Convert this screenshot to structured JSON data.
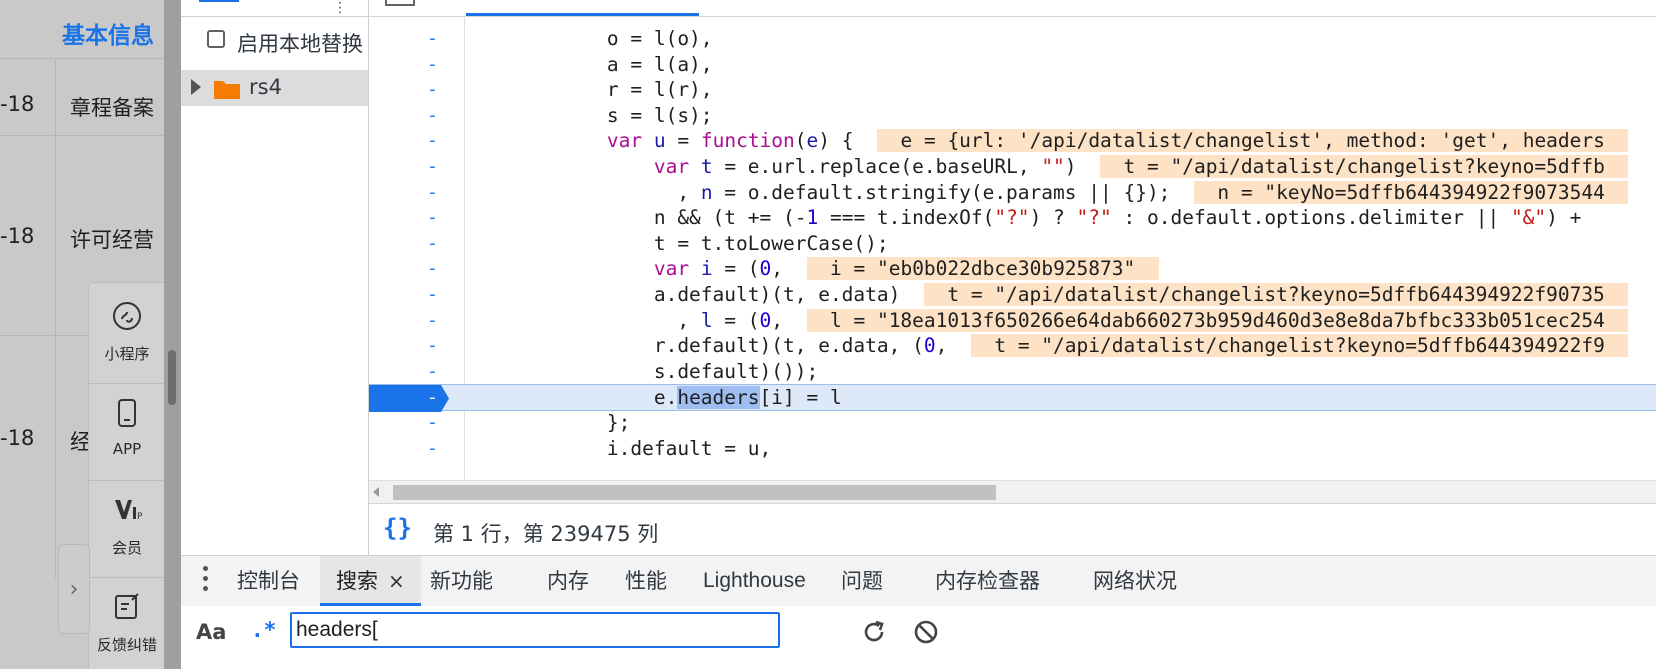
{
  "background_page": {
    "title": "基本信息",
    "dates": [
      "-18",
      "-18",
      "-18"
    ],
    "cells": [
      "章程备案",
      "许可经营",
      "经"
    ],
    "side_items": [
      {
        "label": "小程序",
        "icon": "mini-program-icon"
      },
      {
        "label": "APP",
        "icon": "phone-icon"
      },
      {
        "label": "会员",
        "icon": "vip-icon"
      },
      {
        "label": "反馈纠错",
        "icon": "feedback-edit-icon"
      }
    ]
  },
  "navigator": {
    "checkbox_label": "启用本地替换",
    "folder_name": "rs4",
    "folder_icon_color": "#f57c00"
  },
  "editor": {
    "gutter_marker": "-",
    "lines": [
      {
        "code": "            o = l(o),"
      },
      {
        "code": "            a = l(a),"
      },
      {
        "code": "            r = l(r),"
      },
      {
        "code": "            s = l(s);"
      },
      {
        "code": "            var u = function(e) {",
        "eval": "e = {url: '/api/datalist/changelist', method: 'get', headers"
      },
      {
        "code": "                var t = e.url.replace(e.baseURL, \"\")",
        "eval": "t = \"/api/datalist/changelist?keyno=5dffb"
      },
      {
        "code": "                  , n = o.default.stringify(e.params || {});",
        "eval": "n = \"keyNo=5dffb644394922f9073544"
      },
      {
        "code": "                n && (t += (-1 === t.indexOf(\"?\") ? \"?\" : o.default.options.delimiter || \"&\") +"
      },
      {
        "code": "                t = t.toLowerCase();"
      },
      {
        "code": "                var i = (0,",
        "eval": "i = \"eb0b022dbce30b925873\""
      },
      {
        "code": "                a.default)(t, e.data)",
        "eval": "t = \"/api/datalist/changelist?keyno=5dffb644394922f90735"
      },
      {
        "code": "                  , l = (0,",
        "eval": "l = \"18ea1013f650266e64dab660273b959d460d3e8e8da7bfbc333b051cec254"
      },
      {
        "code": "                r.default)(t, e.data, (0,",
        "eval": "t = \"/api/datalist/changelist?keyno=5dffb644394922f9"
      },
      {
        "code": "                s.default)());"
      },
      {
        "code": "                e.headers[i] = l",
        "active": true
      },
      {
        "code": "            };"
      },
      {
        "code": "            i.default = u,"
      }
    ],
    "status": "第 1 行，第 239475 列",
    "brace_symbol": "{}"
  },
  "drawer": {
    "tabs": [
      {
        "label": "控制台"
      },
      {
        "label": "搜索",
        "active": true,
        "closable": true
      },
      {
        "label": "新功能"
      },
      {
        "label": "内存"
      },
      {
        "label": "性能"
      },
      {
        "label": "Lighthouse"
      },
      {
        "label": "问题"
      },
      {
        "label": "内存检查器"
      },
      {
        "label": "网络状况"
      }
    ],
    "close_symbol": "×"
  },
  "search": {
    "match_case_label": "Aa",
    "regex_label": ".*",
    "query": "headers["
  },
  "colors": {
    "accent": "#1a73e8",
    "keyword": "#aa0d91",
    "string": "#c41a16",
    "number": "#1c00cf",
    "eval_highlight": "#fde2c5",
    "active_line": "#dde8f8"
  }
}
